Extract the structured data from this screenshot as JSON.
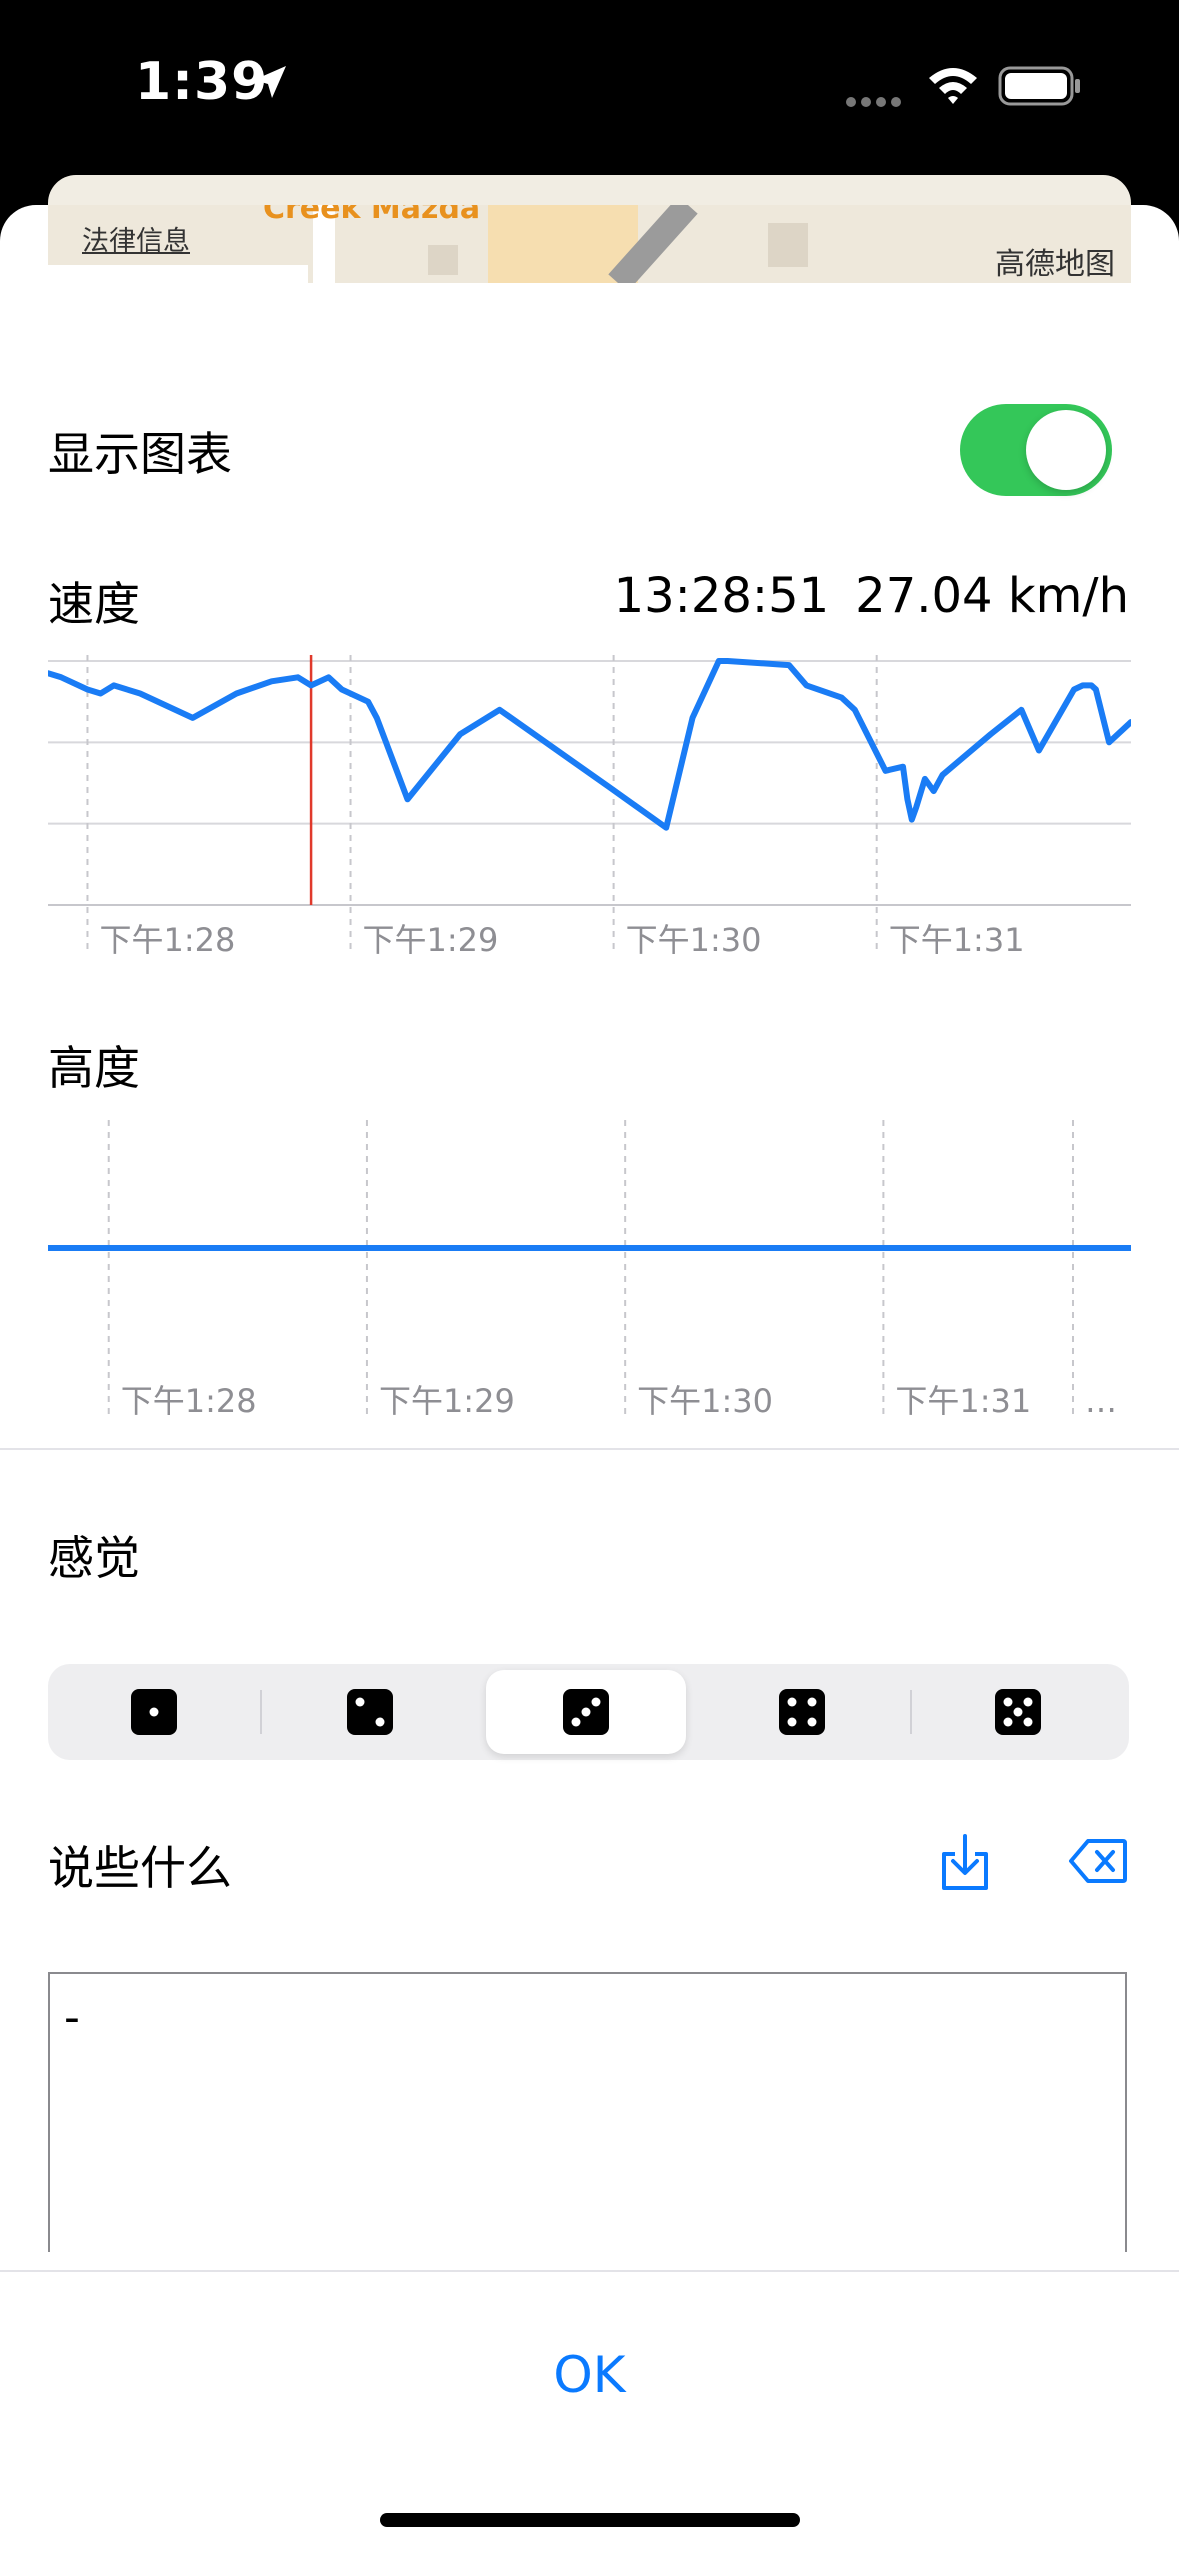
{
  "status_bar": {
    "time": "1:39"
  },
  "map": {
    "legal_label": "法律信息",
    "brand_label": "高德地图",
    "poi_label": "Creek Mazda"
  },
  "show_chart": {
    "label": "显示图表",
    "enabled": true
  },
  "speed": {
    "label": "速度",
    "selected_time": "13:28:51",
    "selected_value": "27.04 km/h",
    "x_ticks": [
      "下午1:28",
      "下午1:29",
      "下午1:30",
      "下午1:31"
    ]
  },
  "altitude": {
    "label": "高度",
    "x_ticks": [
      "下午1:28",
      "下午1:29",
      "下午1:30",
      "下午1:31",
      "…"
    ]
  },
  "feeling": {
    "label": "感觉",
    "options": [
      "1",
      "2",
      "3",
      "4",
      "5"
    ],
    "selected_index": 2
  },
  "note": {
    "label": "说些什么",
    "text": "-"
  },
  "ok_label": "OK",
  "colors": {
    "accent": "#0a7aff",
    "toggle_on": "#34c759",
    "line": "#1a7cf5",
    "cursor": "#e0392b"
  },
  "chart_data": [
    {
      "type": "line",
      "title": "速度",
      "x": [
        "13:27:51",
        "13:27:54",
        "13:28:00",
        "13:28:03",
        "13:28:06",
        "13:28:12",
        "13:28:24",
        "13:28:34",
        "13:28:42",
        "13:28:48",
        "13:28:51",
        "13:28:55",
        "13:28:58",
        "13:29:04",
        "13:29:06",
        "13:29:13",
        "13:29:25",
        "13:29:34",
        "13:29:59",
        "13:30:12",
        "13:30:18",
        "13:30:24",
        "13:30:26",
        "13:30:40",
        "13:30:44",
        "13:30:52",
        "13:30:55",
        "13:31:02",
        "13:31:06",
        "13:31:07",
        "13:31:08",
        "13:31:09",
        "13:31:11",
        "13:31:13",
        "13:31:15",
        "13:31:26",
        "13:31:33",
        "13:31:37",
        "13:31:45",
        "13:31:47",
        "13:31:49",
        "13:31:50",
        "13:31:53",
        "13:31:58"
      ],
      "series": [
        {
          "values": [
            28.5,
            28.0,
            26.5,
            26.0,
            27.0,
            26.0,
            23.0,
            26.0,
            27.5,
            28.0,
            27.0,
            28.0,
            26.5,
            25.0,
            23.0,
            13.0,
            21.0,
            24.0,
            14.5,
            9.5,
            23.0,
            30.0,
            30.0,
            29.5,
            27.0,
            25.5,
            24.0,
            16.5,
            17.0,
            13.0,
            10.5,
            12.0,
            15.5,
            14.0,
            16.0,
            21.0,
            24.0,
            19.0,
            26.5,
            27.0,
            27.0,
            26.5,
            20.0,
            22.5
          ]
        }
      ],
      "x_ticks": [
        "下午1:28",
        "下午1:29",
        "下午1:30",
        "下午1:31"
      ],
      "ylim": [
        0,
        30
      ],
      "grid": true,
      "cursor_x": "13:28:51"
    },
    {
      "type": "line",
      "title": "高度",
      "x": [
        "13:27:51",
        "13:31:58"
      ],
      "series": [
        {
          "values": [
            0,
            0
          ]
        }
      ],
      "x_ticks": [
        "下午1:28",
        "下午1:29",
        "下午1:30",
        "下午1:31",
        "…"
      ],
      "grid": true
    }
  ]
}
